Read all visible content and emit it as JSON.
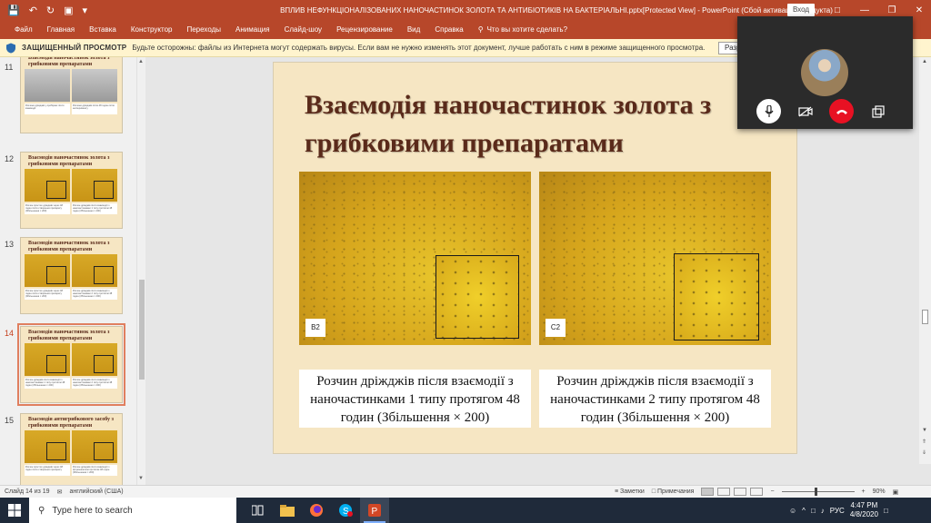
{
  "window": {
    "title": "ВПЛИВ НЕФУНКЦІОНАЛІЗОВАНИХ НАНОЧАСТИНОК ЗОЛОТА ТА АНТИБІОТИКІВ НА БАКТЕРІАЛЬНІ.pptx[Protected View]  -  PowerPoint (Сбой активации продукта)",
    "signin_label": "Вход",
    "accent_color": "#b7472a"
  },
  "ribbon": {
    "tabs": [
      "Файл",
      "Главная",
      "Вставка",
      "Конструктор",
      "Переходы",
      "Анимация",
      "Слайд-шоу",
      "Рецензирование",
      "Вид",
      "Справка"
    ],
    "tellme": "Что вы хотите сделать?"
  },
  "protected": {
    "label": "ЗАЩИЩЕННЫЙ ПРОСМОТР",
    "message": "Будьте осторожны: файлы из Интернета могут содержать вирусы. Если вам не нужно изменять этот документ, лучше работать с ним в режиме защищенного просмотра.",
    "enable_label": "Разр"
  },
  "thumbnails": [
    {
      "num": "11",
      "title": "Взаємодія наночастинок золота з грибковими препаратами",
      "caps": [
        "Розчини дріжджів у пробірках після взаємодії",
        "Розчини дріжджів після 48 годин після експерименту"
      ],
      "kind": "gray"
    },
    {
      "num": "12",
      "title": "Взаємодія наночастинок золота з грибковими препаратами",
      "caps": [
        "Розчин простих дріжджів через 48 годин після створення препарату (Збільшення × 200)",
        "Розчин дріжджів після взаємодії з наночастинками 1 типу протягом 48 годин (Збільшення × 200)"
      ],
      "kind": "gold"
    },
    {
      "num": "13",
      "title": "Взаємодія наночастинок золота з грибковими препаратами",
      "caps": [
        "Розчин простих дріжджів через 48 годин після створення препарату (Збільшення × 200)",
        "Розчин дріжджів після взаємодії з наночастинками 2 типу протягом 48 годин (Збільшення × 200)"
      ],
      "kind": "gold"
    },
    {
      "num": "14",
      "title": "Взаємодія наночастинок золота з грибковими препаратами",
      "caps": [
        "Розчин дріжджів після взаємодії з наночастинками 1 типу протягом 48 годин (Збільшення × 200)",
        "Розчин дріжджів після взаємодії з наночастинками 2 типу протягом 48 годин (Збільшення × 200)"
      ],
      "kind": "gold"
    },
    {
      "num": "15",
      "title": "Взаємодія антигрибкового засобу з грибковими препаратами",
      "caps": [
        "Розчин простих дріжджів через 48 годин після створення препарату",
        "Розчин дріжджів після взаємодії з флуконазолом протягом 48 годин (Збільшення × 200)"
      ],
      "kind": "gold"
    }
  ],
  "slide": {
    "title_line1": "Взаємодія наночастинок золота з",
    "title_line2": "грибковими препаратами",
    "left_label": "B2",
    "right_label": "C2",
    "left_caption": "Розчин дріжджів після взаємодії з наночастинками 1 типу протягом 48 годин (Збільшення × 200)",
    "right_caption": "Розчин дріжджів після взаємодії з наночастинками 2 типу протягом 48 годин (Збільшення × 200)"
  },
  "status": {
    "slide_of": "Слайд 14 из 19",
    "language": "английский (США)",
    "notes": "Заметки",
    "comments": "Примечания",
    "zoom": "90%"
  },
  "taskbar": {
    "search_placeholder": "Type here to search",
    "lang": "РУС",
    "time": "4:47 PM",
    "date": "4/8/2020"
  }
}
